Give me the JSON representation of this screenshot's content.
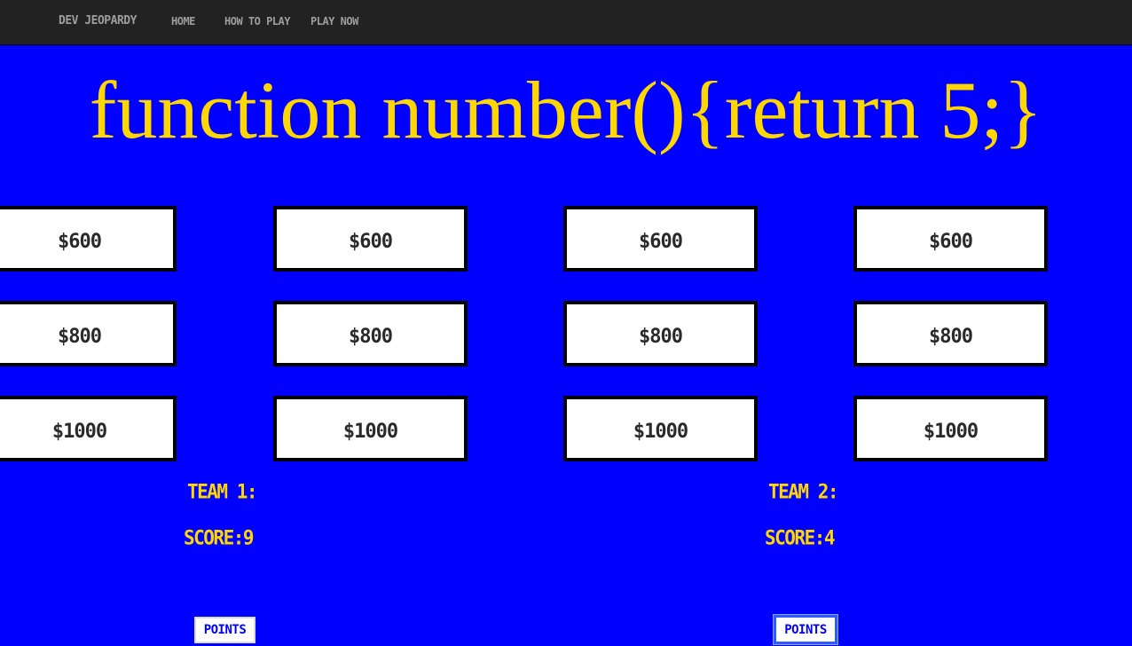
{
  "nav": {
    "brand": "DEV JEOPARDY",
    "links": [
      "HOME",
      "HOW TO PLAY",
      "PLAY NOW"
    ]
  },
  "question": "function number(){return 5;}",
  "board": {
    "rows": [
      [
        "$600",
        "$600",
        "$600",
        "$600"
      ],
      [
        "$800",
        "$800",
        "$800",
        "$800"
      ],
      [
        "$1000",
        "$1000",
        "$1000",
        "$1000"
      ]
    ]
  },
  "teams": [
    {
      "name": "TEAM 1:",
      "score": "SCORE:9",
      "button": "POINTS"
    },
    {
      "name": "TEAM 2:",
      "score": "SCORE:4",
      "button": "POINTS"
    }
  ],
  "colors": {
    "background": "#0000ff",
    "navbar": "#222222",
    "accent": "#ffd700",
    "tile": "#ffffff"
  }
}
